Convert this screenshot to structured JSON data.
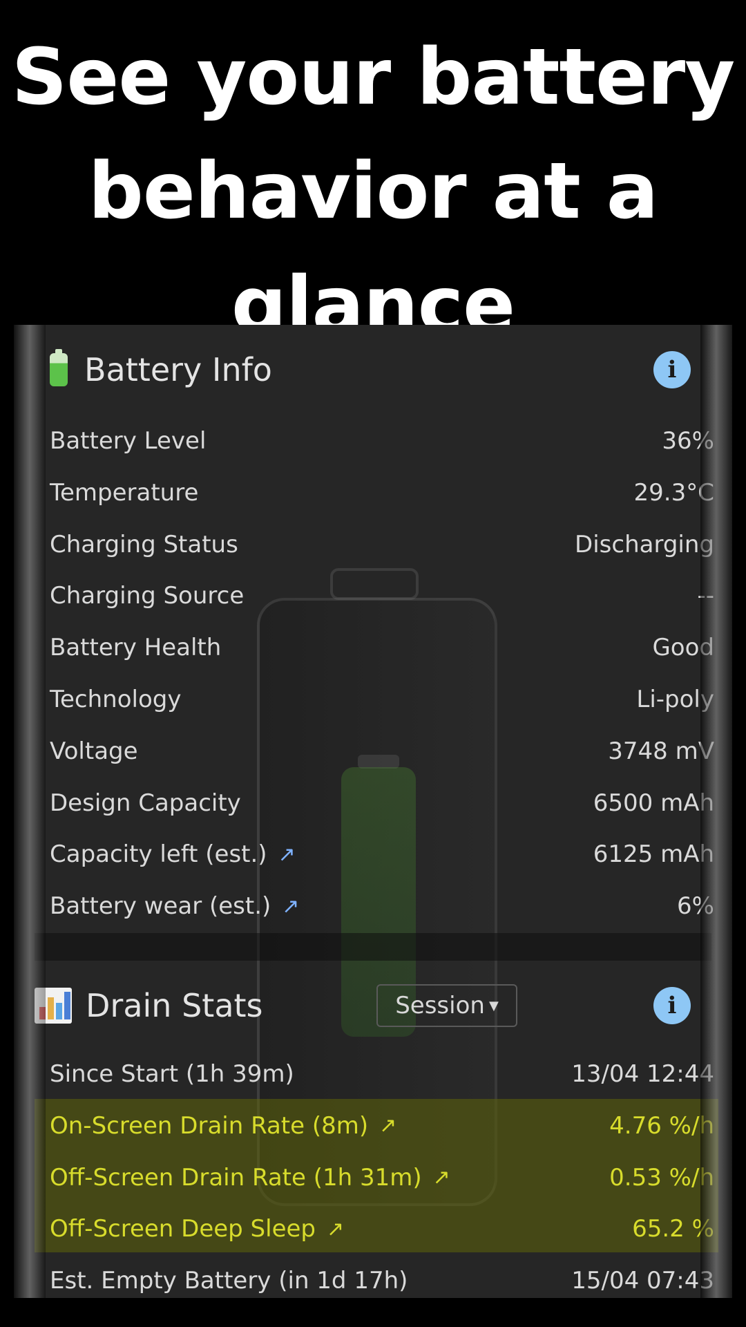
{
  "headline": {
    "line1": "See your battery",
    "line2": "behavior at a",
    "line3": "glance"
  },
  "battery_info": {
    "title": "Battery Info",
    "info_icon": "info-icon",
    "info_glyph": "i",
    "rows": [
      {
        "label": "Battery Level",
        "value": "36%"
      },
      {
        "label": "Temperature",
        "value": "29.3°C"
      },
      {
        "label": "Charging Status",
        "value": "Discharging"
      },
      {
        "label": "Charging Source",
        "value": "--"
      },
      {
        "label": "Battery Health",
        "value": "Good"
      },
      {
        "label": "Technology",
        "value": "Li-poly"
      },
      {
        "label": "Voltage",
        "value": "3748 mV"
      },
      {
        "label": "Design Capacity",
        "value": "6500 mAh"
      },
      {
        "label": "Capacity left (est.)",
        "value": "6125 mAh",
        "trend": "↗"
      },
      {
        "label": "Battery wear (est.)",
        "value": "6%",
        "trend": "↗"
      }
    ]
  },
  "drain_stats": {
    "title": "Drain Stats",
    "dropdown_value": "Session",
    "info_glyph": "i",
    "rows": [
      {
        "label": "Since Start (1h 39m)",
        "value": "13/04 12:44"
      },
      {
        "label": "On-Screen Drain Rate (8m)",
        "value": "4.76 %/h",
        "trend": "↗"
      },
      {
        "label": "Off-Screen Drain Rate (1h 31m)",
        "value": "0.53 %/h",
        "trend": "↗"
      },
      {
        "label": "Off-Screen Deep Sleep",
        "value": "65.2 %",
        "trend": "↗"
      },
      {
        "label": "Est. Empty Battery (in 1d 17h)",
        "value": "15/04 07:43"
      }
    ]
  },
  "colors": {
    "accent_info": "#8ec7f5",
    "highlight_text": "#d8dc2c",
    "trend_blue": "#7fb2ff",
    "panel_bg": "#262626"
  }
}
